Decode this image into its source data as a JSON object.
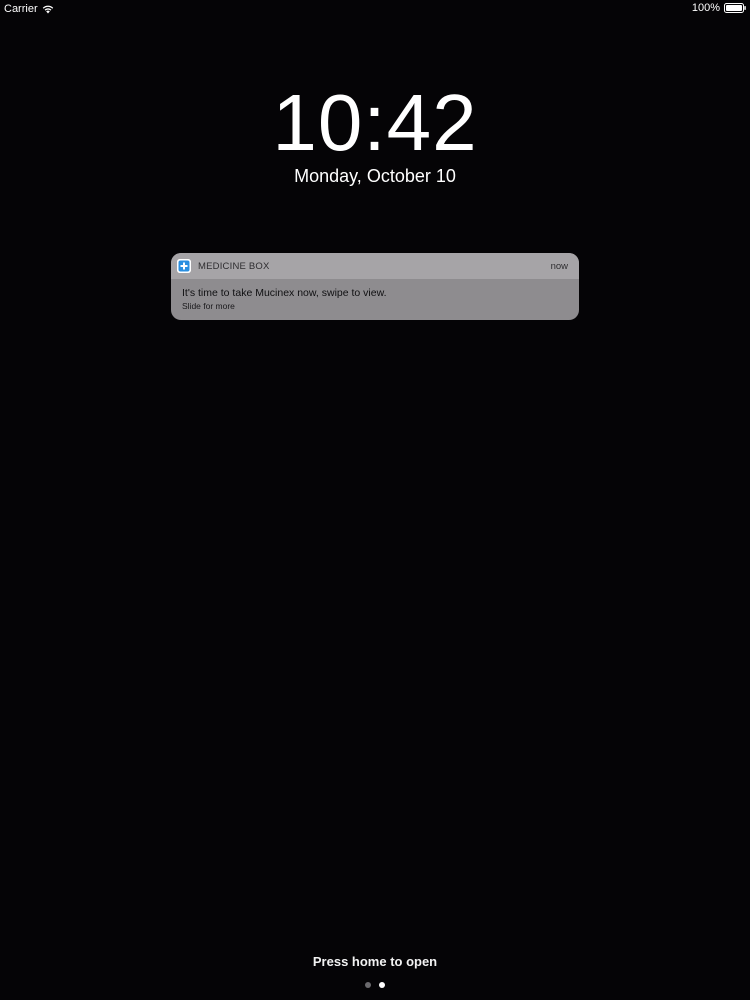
{
  "status_bar": {
    "carrier": "Carrier",
    "battery": "100%",
    "icons": [
      "wifi-icon",
      "battery-icon"
    ]
  },
  "lock_screen": {
    "time": "10:42",
    "date": "Monday, October 10"
  },
  "notification": {
    "app_name": "MEDICINE BOX",
    "time": "now",
    "message": "It's time to take Mucinex now, swipe to view.",
    "hint": "Slide for more",
    "icon": "medicine-box-app-icon",
    "accent_color": "#2a8fe0"
  },
  "footer": {
    "prompt": "Press home to open",
    "page_count": 2,
    "active_page": 2
  },
  "colors": {
    "background": "#050406",
    "notification_bg": "#8e8c8f",
    "notification_header_bg": "#a6a4a7"
  }
}
